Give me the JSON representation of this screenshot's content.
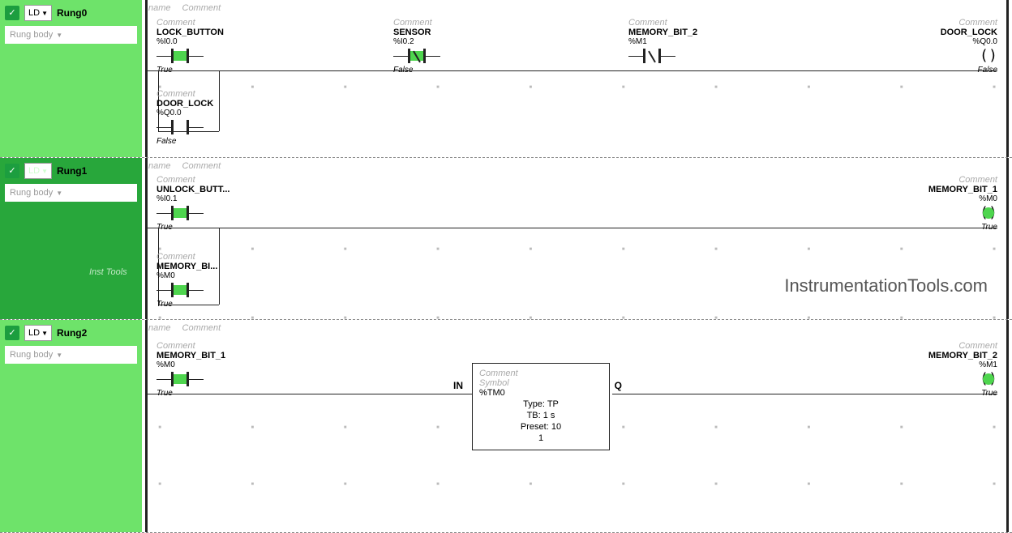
{
  "watermark_side": "Inst Tools",
  "watermark_main": "InstrumentationTools.com",
  "header": {
    "name_lbl": "name",
    "comment_lbl": "Comment"
  },
  "common": {
    "comment_lbl": "Comment",
    "ld_label": "LD",
    "body_label": "Rung body"
  },
  "rung0": {
    "title": "Rung0",
    "lock_button": {
      "sym": "LOCK_BUTTON",
      "addr": "%I0.0",
      "state": "True"
    },
    "sensor": {
      "sym": "SENSOR",
      "addr": "%I0.2",
      "state": "False"
    },
    "mem2": {
      "sym": "MEMORY_BIT_2",
      "addr": "%M1"
    },
    "door_lock_coil": {
      "sym": "DOOR_LOCK",
      "addr": "%Q0.0",
      "state": "False"
    },
    "door_lock_branch": {
      "sym": "DOOR_LOCK",
      "addr": "%Q0.0",
      "state": "False"
    }
  },
  "rung1": {
    "title": "Rung1",
    "unlock_button": {
      "sym": "UNLOCK_BUTT...",
      "addr": "%I0.1",
      "state": "True"
    },
    "mem1_branch": {
      "sym": "MEMORY_BI...",
      "addr": "%M0",
      "state": "True"
    },
    "mem1_coil": {
      "sym": "MEMORY_BIT_1",
      "addr": "%M0",
      "state": "True"
    }
  },
  "rung2": {
    "title": "Rung2",
    "mem1_contact": {
      "sym": "MEMORY_BIT_1",
      "addr": "%M0",
      "state": "True"
    },
    "timer": {
      "cmt": "Comment",
      "sym_lbl": "Symbol",
      "addr": "%TM0",
      "type_line": "Type: TP",
      "tb_line": "TB: 1 s",
      "preset_line": "Preset: 10",
      "val_line": "1",
      "in": "IN",
      "q": "Q"
    },
    "mem2_coil": {
      "sym": "MEMORY_BIT_2",
      "addr": "%M1",
      "state": "True"
    }
  }
}
